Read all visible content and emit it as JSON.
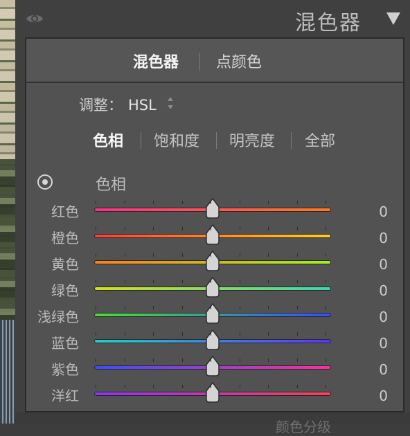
{
  "header": {
    "title": "混色器",
    "icons": [
      "eye-icon",
      "collapse-triangle-icon"
    ]
  },
  "tabs": {
    "mixer": "混色器",
    "point_color": "点颜色",
    "separator": "|"
  },
  "adjust": {
    "label": "调整：",
    "value": "HSL",
    "control_icon": "updown-arrows-icon"
  },
  "subtabs": [
    {
      "label": "色相",
      "active": true
    },
    {
      "label": "饱和度",
      "active": false
    },
    {
      "label": "明亮度",
      "active": false
    },
    {
      "label": "全部",
      "active": false
    }
  ],
  "section": {
    "icon": "target-adjust-icon",
    "title": "色相"
  },
  "sliders": [
    {
      "label": "红色",
      "value": "0",
      "gradient": [
        "#ff2e8b",
        "#ff7a1a"
      ]
    },
    {
      "label": "橙色",
      "value": "0",
      "gradient": [
        "#ff3d3d",
        "#ffd21a"
      ]
    },
    {
      "label": "黄色",
      "value": "0",
      "gradient": [
        "#ff7f1a",
        "#9df21b"
      ]
    },
    {
      "label": "绿色",
      "value": "0",
      "gradient": [
        "#d6df15",
        "#35d9b3"
      ]
    },
    {
      "label": "浅绿色",
      "value": "0",
      "gradient": [
        "#49df32",
        "#344fff"
      ]
    },
    {
      "label": "蓝色",
      "value": "0",
      "gradient": [
        "#22d0bc",
        "#5f32ff"
      ]
    },
    {
      "label": "紫色",
      "value": "0",
      "gradient": [
        "#3c4dff",
        "#ff2ca0"
      ]
    },
    {
      "label": "洋红",
      "value": "0",
      "gradient": [
        "#8f31ff",
        "#ff3e56"
      ]
    }
  ],
  "bottom_partial": "颜色分级"
}
